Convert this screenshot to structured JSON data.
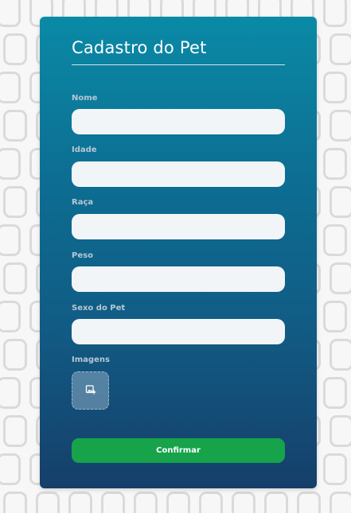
{
  "form": {
    "title": "Cadastro do Pet",
    "fields": [
      {
        "label": "Nome",
        "value": "",
        "placeholder": ""
      },
      {
        "label": "Idade",
        "value": "",
        "placeholder": ""
      },
      {
        "label": "Raça",
        "value": "",
        "placeholder": ""
      },
      {
        "label": "Peso",
        "value": "",
        "placeholder": ""
      },
      {
        "label": "Sexo do Pet",
        "value": "",
        "placeholder": ""
      }
    ],
    "images_label": "Imagens",
    "upload_icon": "add-photo-icon",
    "confirm_label": "Confirmar"
  },
  "colors": {
    "page_background": "#f7f7f7",
    "card_gradient_top": "#0a8aa6",
    "card_gradient_bottom": "#153f6a",
    "input_background": "#f2f5f8",
    "confirm_button": "#16a34a",
    "label_text": "#b6c8d4"
  }
}
